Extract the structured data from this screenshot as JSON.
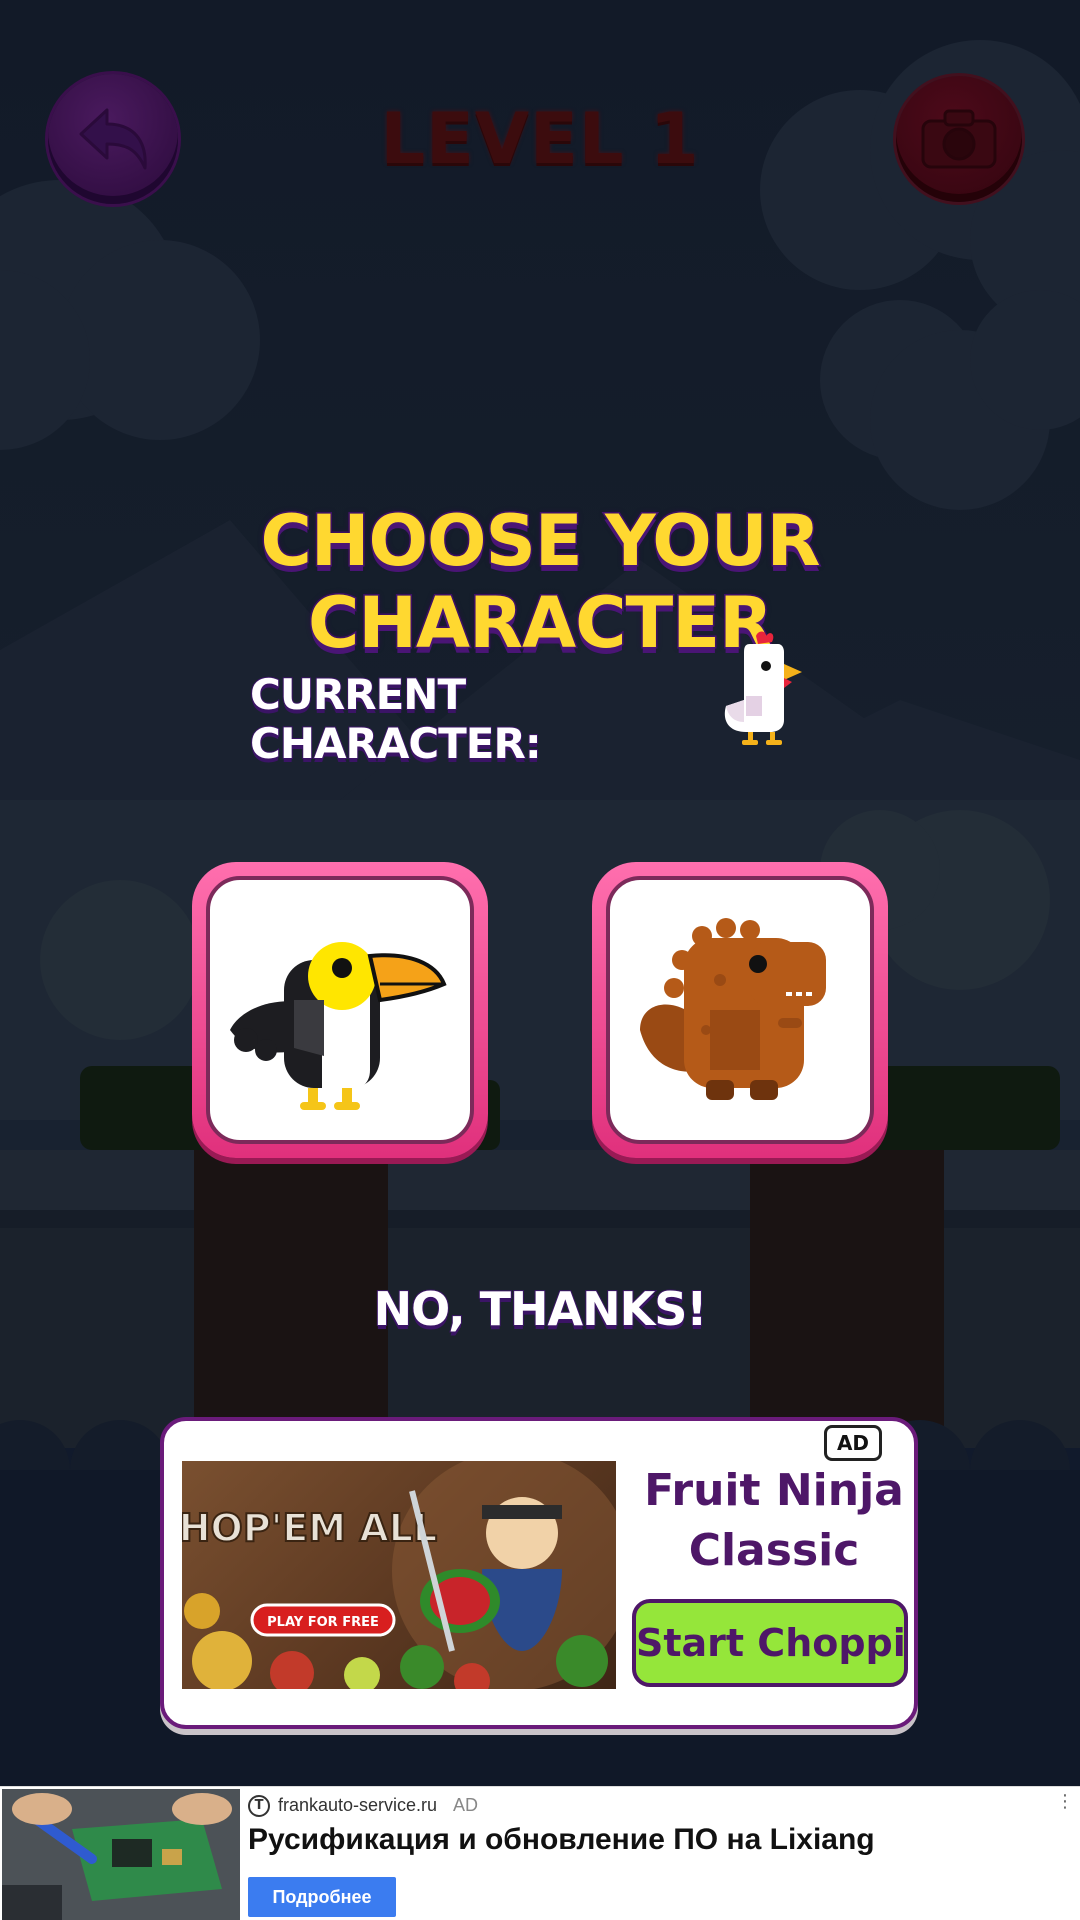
{
  "header": {
    "level_title": "LEVEL 1",
    "back_icon": "back-arrow-icon",
    "camera_icon": "camera-icon"
  },
  "selector": {
    "title": "CHOOSE YOUR CHARACTER",
    "current_label": "CURRENT CHARACTER:",
    "current_character": "chicken",
    "options": [
      {
        "character": "toucan"
      },
      {
        "character": "dinosaur"
      }
    ],
    "skip_label": "NO, THANKS!"
  },
  "ad_card": {
    "badge": "AD",
    "image_headline": "CHOP'EM ALL",
    "image_button": "PLAY FOR FREE",
    "app_name": "Fruit Ninja Classic",
    "cta": "Start Chopping"
  },
  "bottom_ad": {
    "domain_icon": "Т",
    "domain": "frankauto-service.ru",
    "tag": "AD",
    "headline": "Русификация и обновление ПО на Lixiang",
    "button": "Подробнее",
    "menu_icon": "⋮"
  },
  "colors": {
    "title_yellow": "#ffd830",
    "outline_purple": "#4a1575",
    "card_pink": "#ff6fae",
    "cta_green": "#95e63a",
    "bottom_button_blue": "#3b7cf0"
  }
}
